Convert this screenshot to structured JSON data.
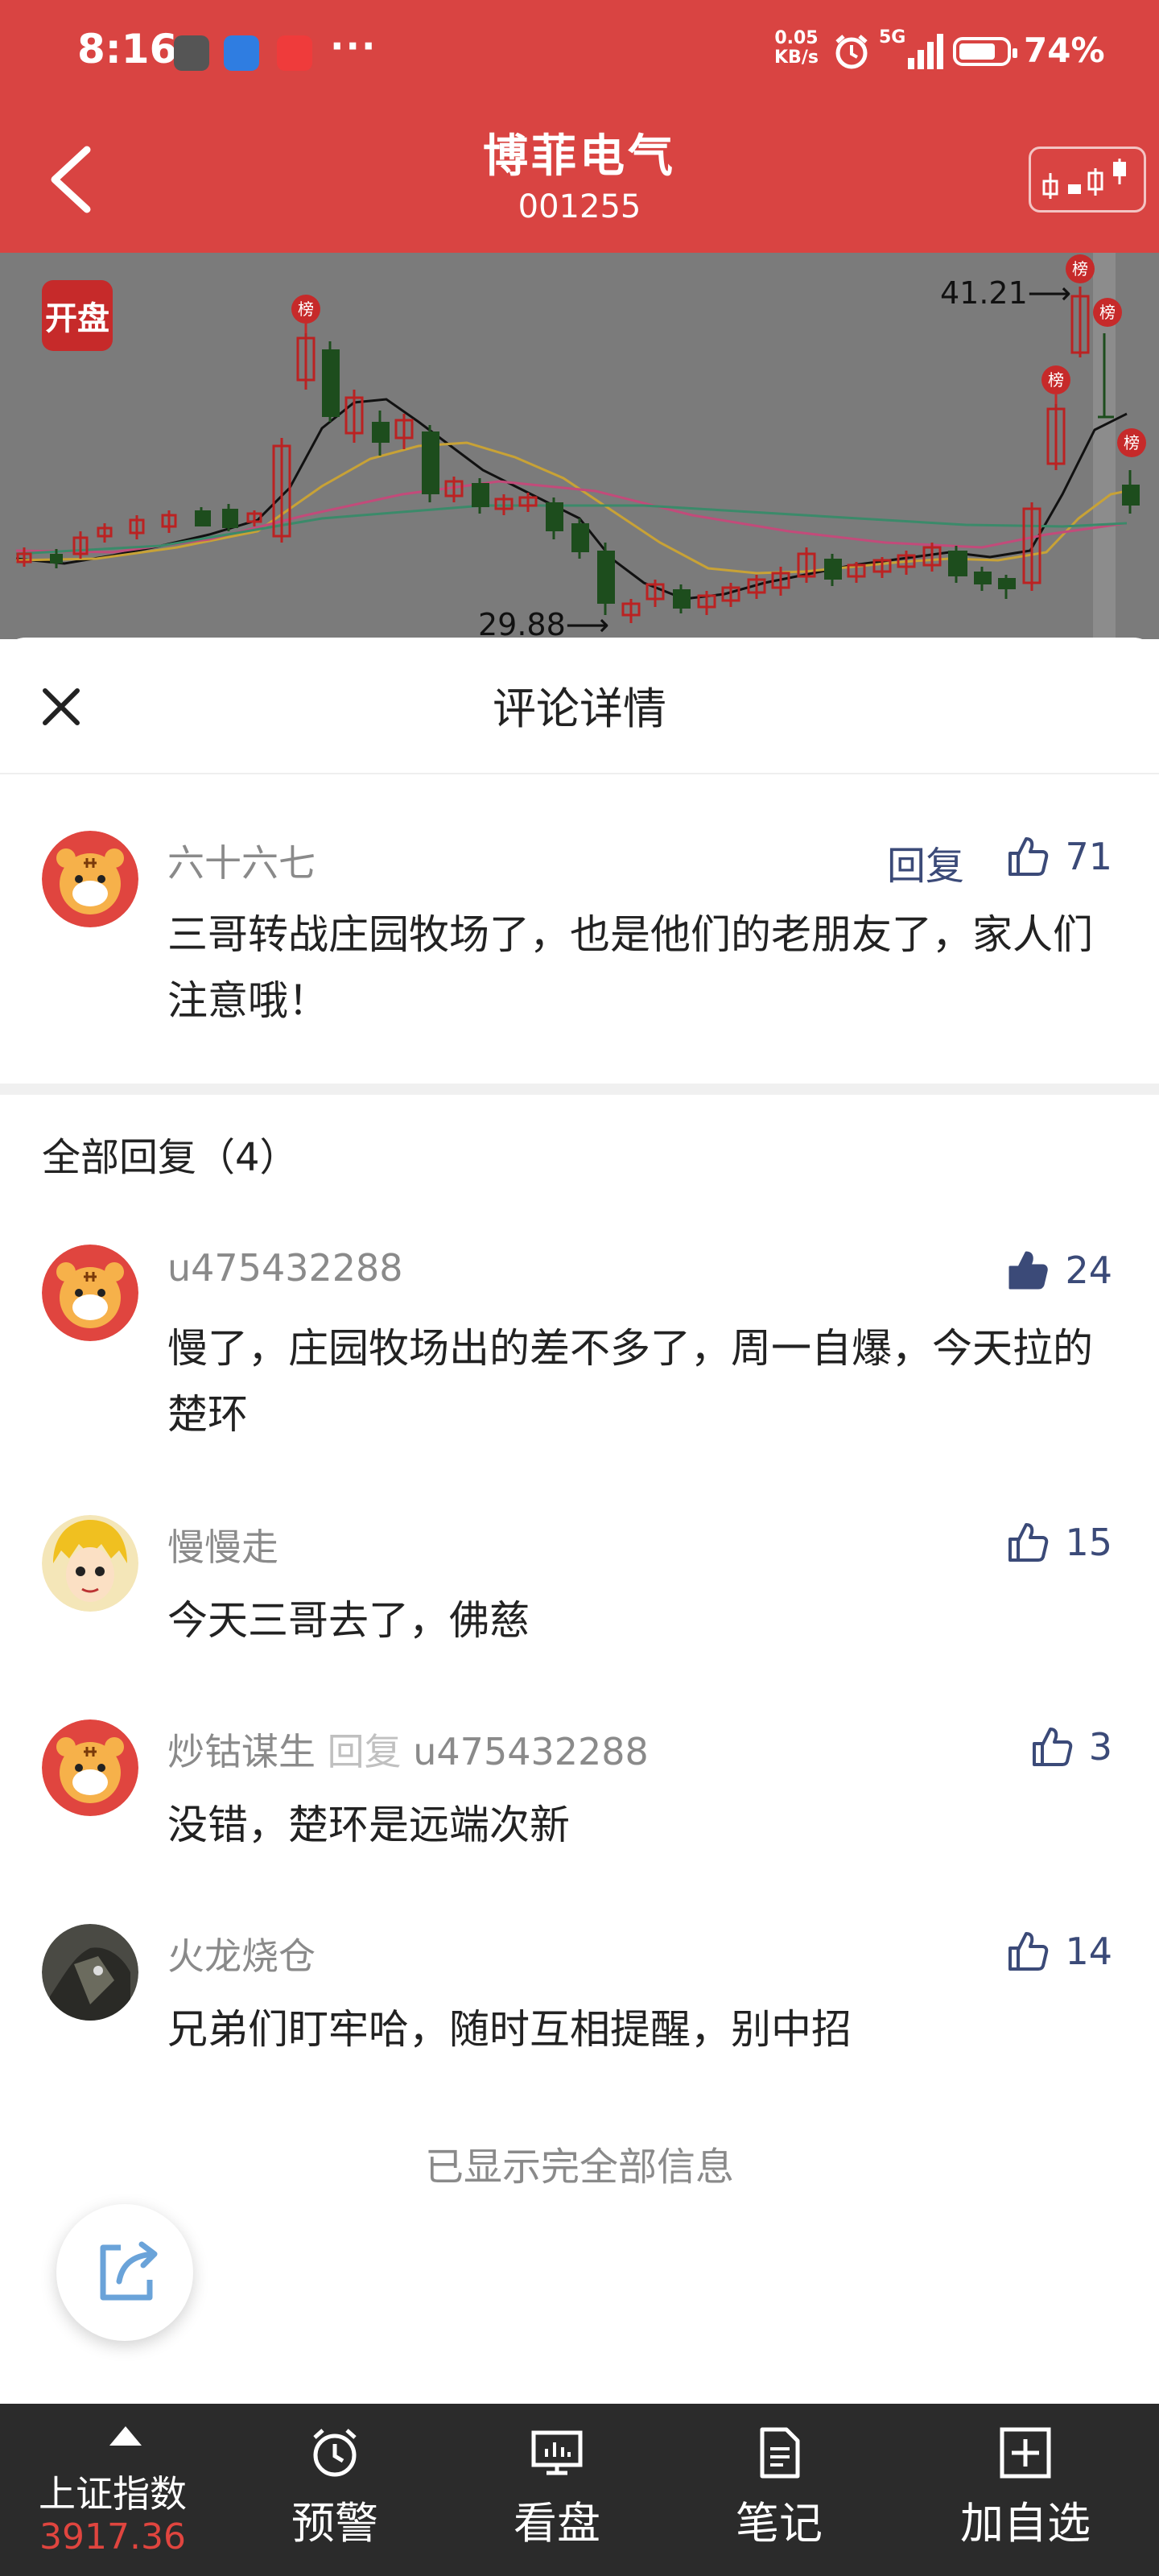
{
  "status": {
    "time": "8:16",
    "net_speed_value": "0.05",
    "net_speed_unit": "KB/s",
    "network": "5G",
    "battery": "74%"
  },
  "header": {
    "stock_name": "博菲电气",
    "stock_code": "001255"
  },
  "chart": {
    "badge": "开盘",
    "high_label": "41.21⟶",
    "low_label": "29.88⟶",
    "rank_marker": "榜"
  },
  "sheet": {
    "title": "评论详情"
  },
  "main_comment": {
    "user": "六十六七",
    "reply_label": "回复",
    "likes": "71",
    "text": "三哥转战庄园牧场了，也是他们的老朋友了，家人们注意哦！"
  },
  "replies_title": "全部回复（4）",
  "replies": [
    {
      "user": "u475432288",
      "reply_word": "",
      "reply_to": "",
      "likes": "24",
      "text": "慢了，庄园牧场出的差不多了，周一自爆，今天拉的楚环",
      "liked": true
    },
    {
      "user": "慢慢走",
      "reply_word": "",
      "reply_to": "",
      "likes": "15",
      "text": "今天三哥去了，佛慈",
      "liked": false
    },
    {
      "user": "炒钴谋生",
      "reply_word": "回复",
      "reply_to": "u475432288",
      "likes": "3",
      "text": "没错，楚环是远端次新",
      "liked": false
    },
    {
      "user": "火龙烧仓",
      "reply_word": "",
      "reply_to": "",
      "likes": "14",
      "text": "兄弟们盯牢哈，随时互相提醒，别中招",
      "liked": false
    }
  ],
  "footer_note": "已显示完全部信息",
  "bottom_nav": {
    "index_name": "上证指数",
    "index_value": "3917.36",
    "items": [
      "预警",
      "看盘",
      "笔记",
      "加自选"
    ]
  },
  "colors": {
    "brand_red": "#d94442",
    "like_blue": "#3b4a78",
    "index_red": "#e0453f"
  }
}
